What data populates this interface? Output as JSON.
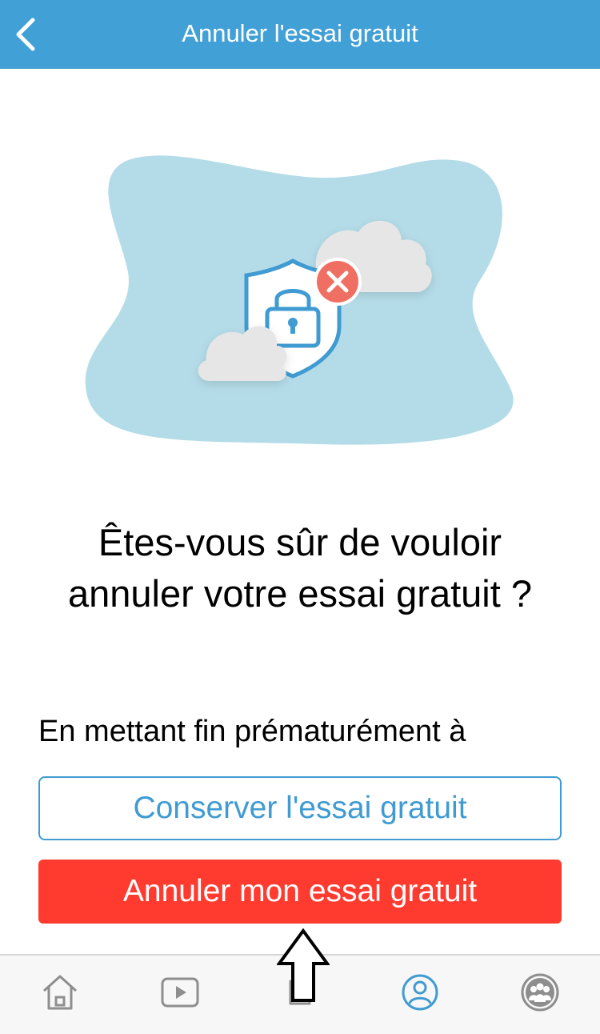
{
  "navbar": {
    "title": "Annuler l'essai gratuit",
    "back_icon": "chevron-left-icon",
    "background": "#41a0d6"
  },
  "illustration": {
    "icons": [
      "shield-lock-icon",
      "close-badge-icon",
      "cloud-icon"
    ]
  },
  "dialog": {
    "question": "Êtes-vous sûr de vouloir annuler votre essai gratuit ?",
    "body": "En mettant fin prématurément à"
  },
  "actions": {
    "keep_label": "Conserver l'essai gratuit",
    "cancel_label": "Annuler mon essai gratuit",
    "keep_color": "#3f9bd2",
    "cancel_color": "#ff3b30"
  },
  "tabbar": {
    "tabs": [
      {
        "icon": "home-icon",
        "active": false
      },
      {
        "icon": "play-video-icon",
        "active": false
      },
      {
        "icon": "puzzle-icon",
        "active": false
      },
      {
        "icon": "profile-icon",
        "active": true
      },
      {
        "icon": "community-icon",
        "active": false
      }
    ],
    "active_color": "#3f9bd2",
    "inactive_color": "#8e8e8e"
  },
  "annotation": {
    "icon": "up-arrow-icon"
  }
}
